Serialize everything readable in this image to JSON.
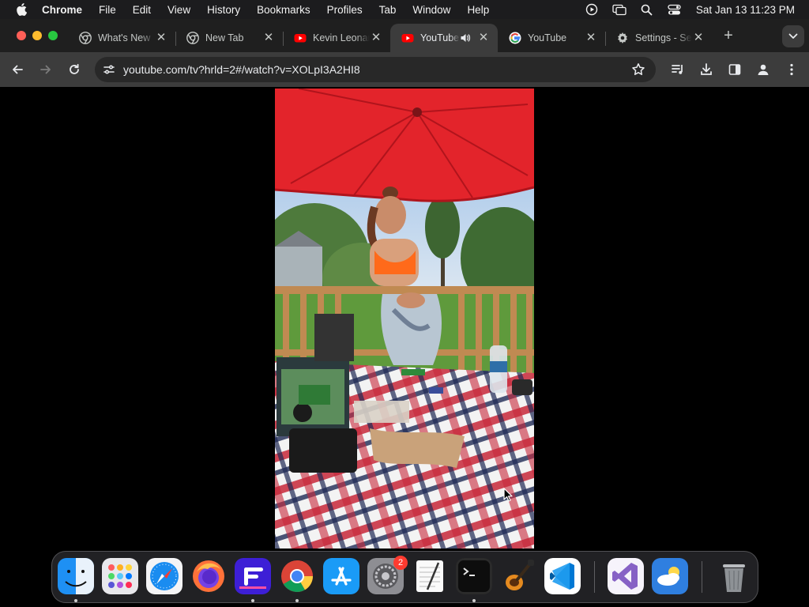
{
  "menubar": {
    "app_name": "Chrome",
    "menus": [
      "File",
      "Edit",
      "View",
      "History",
      "Bookmarks",
      "Profiles",
      "Tab",
      "Window",
      "Help"
    ],
    "clock": "Sat Jan 13  11:23 PM"
  },
  "tabs": [
    {
      "title": "What's New",
      "icon": "chrome-icon",
      "active": false
    },
    {
      "title": "New Tab",
      "icon": "chrome-icon",
      "active": false
    },
    {
      "title": "Kevin Leonard",
      "icon": "youtube-icon",
      "active": false
    },
    {
      "title": "YouTube",
      "icon": "youtube-icon",
      "active": true,
      "audio": true
    },
    {
      "title": "YouTube",
      "icon": "google-icon",
      "active": false
    },
    {
      "title": "Settings - Search engine",
      "icon": "gear-icon",
      "active": false
    }
  ],
  "toolbar": {
    "url": "youtube.com/tv?hrld=2#/watch?v=XOLpI3A2HI8"
  },
  "dock": {
    "apps": [
      "Finder",
      "Launchpad",
      "Safari",
      "Firefox",
      "Fenix",
      "Google Chrome",
      "App Store",
      "System Settings",
      "TextEdit",
      "Terminal",
      "GarageBand",
      "Visual Studio Code",
      "Visual Studio",
      "Weather",
      "Trash"
    ],
    "settings_badge": "2"
  },
  "colors": {
    "menubar_bg": "#1c1c1e",
    "tabstrip_bg": "#1f1f1f",
    "toolbar_bg": "#3c3c3c",
    "omnibox_bg": "#282828",
    "youtube_red": "#ff0000"
  }
}
